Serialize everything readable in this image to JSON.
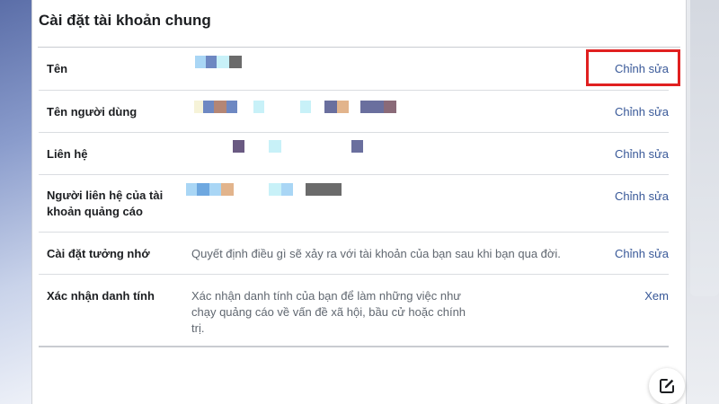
{
  "page": {
    "title": "Cài đặt tài khoản chung"
  },
  "rows": [
    {
      "label": "Tên",
      "value": "",
      "action": "Chỉnh sửa",
      "redacted": true
    },
    {
      "label": "Tên người dùng",
      "value": "",
      "action": "Chỉnh sửa",
      "redacted": true
    },
    {
      "label": "Liên hệ",
      "value": "",
      "action": "Chỉnh sửa",
      "redacted": true
    },
    {
      "label_line1": "Người liên hệ của tài",
      "label_line2": "khoản quảng cáo",
      "value": "",
      "action": "Chỉnh sửa",
      "redacted": true
    },
    {
      "label": "Cài đặt tưởng nhớ",
      "value": "Quyết định điều gì sẽ xảy ra với tài khoản của bạn sau khi bạn qua đời.",
      "action": "Chỉnh sửa"
    },
    {
      "label": "Xác nhận danh tính",
      "value_line1": "Xác nhận danh tính của bạn để làm những việc như",
      "value_line2": "chạy quảng cáo về vấn đề xã hội, bầu cử hoặc chính",
      "value_line3": "trị.",
      "action": "Xem"
    }
  ],
  "colors": {
    "link": "#385898",
    "highlight_box": "#e02020",
    "redaction_pixels": [
      "#a9d6f5",
      "#6a6f9e",
      "#c8f1f8",
      "#6b6b6b",
      "#f6f3d8",
      "#6e88c2",
      "#b48675",
      "#e2b48c",
      "#5c4e73"
    ]
  },
  "icons": {
    "fab": "compose-edit-icon"
  }
}
